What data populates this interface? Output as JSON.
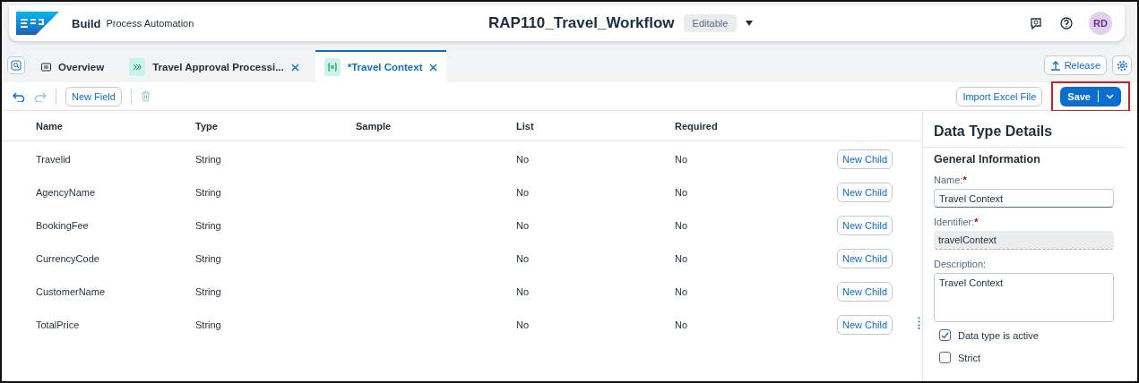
{
  "header": {
    "brand": "Build",
    "product": "Process Automation",
    "title": "RAP110_Travel_Workflow",
    "status": "Editable",
    "avatar": "RD"
  },
  "tabs": [
    {
      "label": "Overview",
      "kind": "overview",
      "selected": false,
      "closable": false
    },
    {
      "label": "Travel Approval Processi...",
      "kind": "process",
      "selected": false,
      "closable": true
    },
    {
      "label": "*Travel Context",
      "kind": "datatype",
      "selected": true,
      "closable": true
    }
  ],
  "release_button": "Release",
  "toolbar": {
    "new_field": "New Field",
    "import": "Import Excel File",
    "save": "Save",
    "save_highlighted": true
  },
  "table": {
    "columns": [
      "Name",
      "Type",
      "Sample",
      "List",
      "Required"
    ],
    "rows": [
      {
        "cells": [
          "Travelid",
          "String",
          "",
          "No",
          "No"
        ],
        "action": "New Child"
      },
      {
        "cells": [
          "AgencyName",
          "String",
          "",
          "No",
          "No"
        ],
        "action": "New Child"
      },
      {
        "cells": [
          "BookingFee",
          "String",
          "",
          "No",
          "No"
        ],
        "action": "New Child"
      },
      {
        "cells": [
          "CurrencyCode",
          "String",
          "",
          "No",
          "No"
        ],
        "action": "New Child"
      },
      {
        "cells": [
          "CustomerName",
          "String",
          "",
          "No",
          "No"
        ],
        "action": "New Child"
      },
      {
        "cells": [
          "TotalPrice",
          "String",
          "",
          "No",
          "No"
        ],
        "action": "New Child"
      }
    ]
  },
  "details": {
    "title": "Data Type Details",
    "section": "General Information",
    "required_mark": "*",
    "name_label": "Name:",
    "name_value": "Travel Context",
    "identifier_label": "Identifier:",
    "identifier_value": "travelContext",
    "description_label": "Description:",
    "description_value": "Travel Context",
    "checkboxes": [
      {
        "label": "Data type is active",
        "checked": true
      },
      {
        "label": "Strict",
        "checked": false
      }
    ]
  }
}
